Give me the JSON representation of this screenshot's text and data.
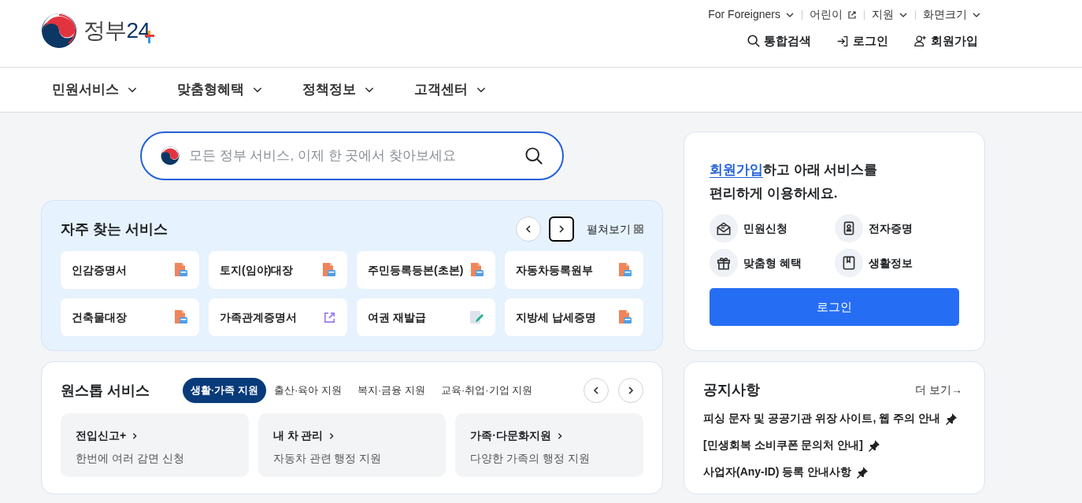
{
  "logo": {
    "text": "정부",
    "number": "24"
  },
  "utility_menu": [
    {
      "label": "For Foreigners",
      "kind": "dropdown"
    },
    {
      "label": "어린이",
      "kind": "external"
    },
    {
      "label": "지원",
      "kind": "dropdown"
    },
    {
      "label": "화면크기",
      "kind": "dropdown"
    }
  ],
  "header_actions": [
    {
      "label": "통합검색",
      "kind": "search"
    },
    {
      "label": "로그인",
      "kind": "login"
    },
    {
      "label": "회원가입",
      "kind": "signup"
    }
  ],
  "main_nav": [
    "민원서비스",
    "맞춤형혜택",
    "정책정보",
    "고객센터"
  ],
  "search": {
    "placeholder": "모든 정부 서비스, 이제 한 곳에서 찾아보세요"
  },
  "frequent_services": {
    "title": "자주 찾는 서비스",
    "prev_focused": false,
    "next_focused": true,
    "expand_label": "펼쳐보기",
    "items": [
      {
        "label": "인감증명서",
        "kind": "pdf"
      },
      {
        "label": "토지(임야)대장",
        "kind": "pdf"
      },
      {
        "label": "주민등록등본(초본)",
        "kind": "pdf"
      },
      {
        "label": "자동차등록원부",
        "kind": "pdf"
      },
      {
        "label": "건축물대장",
        "kind": "pdf"
      },
      {
        "label": "가족관계증명서",
        "kind": "external"
      },
      {
        "label": "여권 재발급",
        "kind": "edit"
      },
      {
        "label": "지방세 납세증명",
        "kind": "pdf"
      }
    ]
  },
  "onestop": {
    "title": "원스톱 서비스",
    "tabs": [
      {
        "label": "생활·가족 지원",
        "selected": true
      },
      {
        "label": "출산·육아 지원",
        "selected": false
      },
      {
        "label": "복지·금융 지원",
        "selected": false
      },
      {
        "label": "교육·취업·기업 지원",
        "selected": false
      }
    ],
    "cards": [
      {
        "title": "전입신고+",
        "desc": "한번에 여러 감면 신청"
      },
      {
        "title": "내 차 관리",
        "desc": "자동차 관련 행정 지원"
      },
      {
        "title": "가족·다문화지원",
        "desc": "다양한 가족의 행정 지원"
      }
    ]
  },
  "login_card": {
    "link": "회원가입",
    "message_line1": "하고 아래 서비스를",
    "message_line2": "편리하게 이용하세요.",
    "features": [
      {
        "label": "민원신청",
        "kind": "mail"
      },
      {
        "label": "전자증명",
        "kind": "certificate"
      },
      {
        "label": "맞춤형 혜택",
        "kind": "gift"
      },
      {
        "label": "생활정보",
        "kind": "book"
      }
    ],
    "button": "로그인"
  },
  "notices": {
    "title": "공지사항",
    "more": "더 보기",
    "arrow": "→",
    "items": [
      {
        "title": "피싱 문자 및 공공기관 위장 사이트, 웹 주의 안내",
        "pinned": true
      },
      {
        "title": "[민생회복 소비쿠폰 문의처 안내]",
        "pinned": true
      },
      {
        "title": "사업자(Any-ID) 등록 안내사항",
        "pinned": true
      }
    ]
  }
}
